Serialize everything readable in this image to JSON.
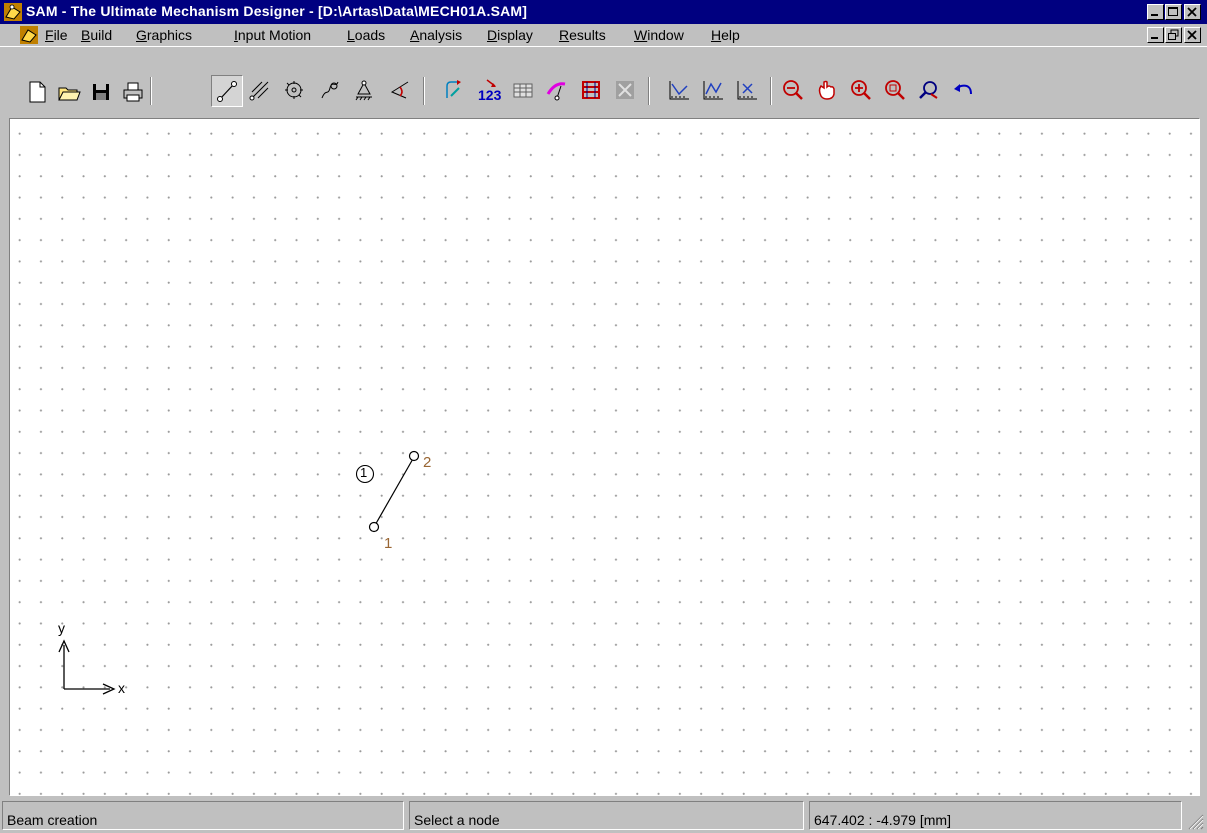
{
  "window": {
    "title": "SAM - The Ultimate Mechanism Designer - [D:\\Artas\\Data\\MECH01A.SAM]"
  },
  "menu": {
    "items": [
      "File",
      "Build",
      "Graphics",
      "Input Motion",
      "Loads",
      "Analysis",
      "Display",
      "Results",
      "Window",
      "Help"
    ]
  },
  "toolbar": {
    "buttons": [
      {
        "name": "new-file-icon",
        "pressed": false
      },
      {
        "name": "open-folder-icon",
        "pressed": false
      },
      {
        "name": "save-disk-icon",
        "pressed": false
      },
      {
        "name": "print-icon",
        "pressed": false
      },
      {
        "name": "beam-icon",
        "pressed": true
      },
      {
        "name": "slider-icon",
        "pressed": false
      },
      {
        "name": "gear-icon",
        "pressed": false
      },
      {
        "name": "spring-icon",
        "pressed": false
      },
      {
        "name": "fixed-support-icon",
        "pressed": false
      },
      {
        "name": "angle-icon",
        "pressed": false
      },
      {
        "name": "input-motion-icon",
        "pressed": false
      },
      {
        "name": "numbering-icon",
        "pressed": false
      },
      {
        "name": "table-icon",
        "pressed": false
      },
      {
        "name": "motion-arrow-icon",
        "pressed": false
      },
      {
        "name": "frame-icon",
        "pressed": false
      },
      {
        "name": "grid-disabled-icon",
        "pressed": false
      },
      {
        "name": "graph-icon",
        "pressed": false
      },
      {
        "name": "graph-multi-icon",
        "pressed": false
      },
      {
        "name": "graph-cross-icon",
        "pressed": false
      },
      {
        "name": "zoom-out-icon",
        "pressed": false
      },
      {
        "name": "pan-hand-icon",
        "pressed": false
      },
      {
        "name": "zoom-in-icon",
        "pressed": false
      },
      {
        "name": "zoom-window-icon",
        "pressed": false
      },
      {
        "name": "zoom-all-icon",
        "pressed": false
      },
      {
        "name": "undo-icon",
        "pressed": false
      }
    ],
    "numbering_glyph": "123"
  },
  "canvas": {
    "beam_label": "1",
    "node_1_label": "1",
    "node_2_label": "2",
    "axis_x_label": "x",
    "axis_y_label": "y"
  },
  "status": {
    "mode": "Beam creation",
    "prompt": "Select a node",
    "coordinates": "647.402 : -4.979 [mm]"
  },
  "colors": {
    "titlebar": "#000080",
    "chrome": "#c0c0c0",
    "node_label": "#996633"
  }
}
